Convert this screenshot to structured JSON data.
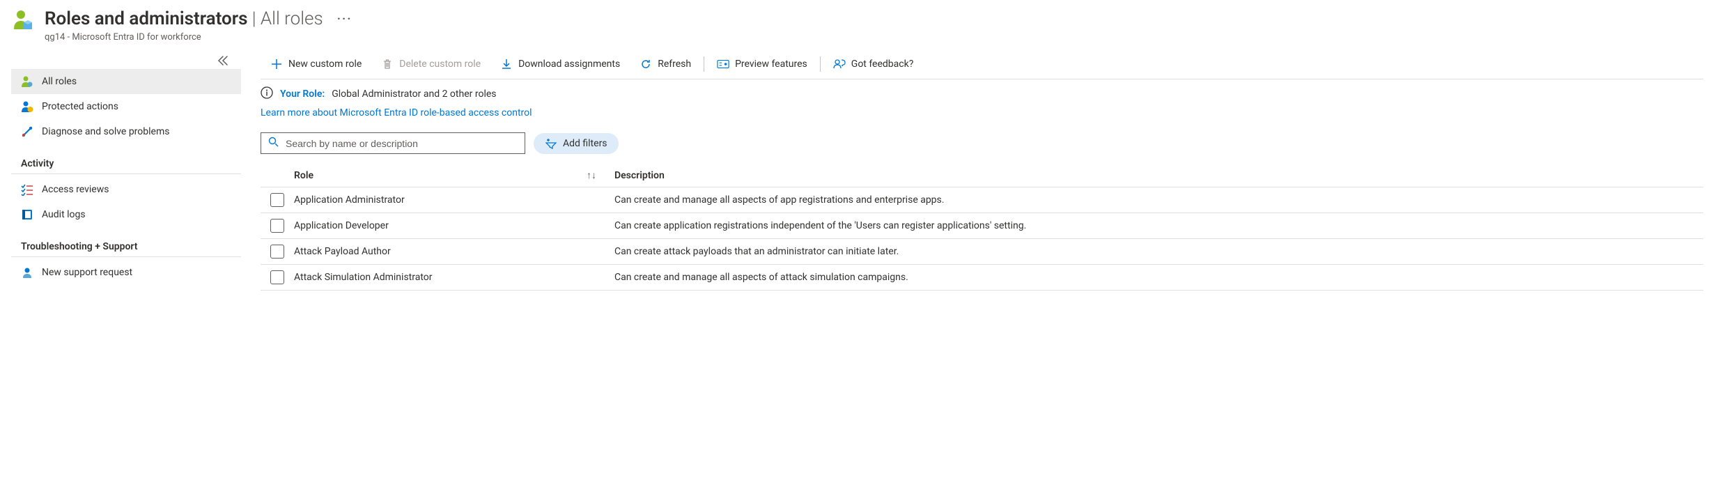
{
  "header": {
    "title_main": "Roles and administrators",
    "title_sep": " | ",
    "title_sub": "All roles",
    "subtitle": "qg14 - Microsoft Entra ID for workforce"
  },
  "sidebar": {
    "items": [
      {
        "label": "All roles",
        "icon": "person-roles-icon",
        "selected": true
      },
      {
        "label": "Protected actions",
        "icon": "person-shield-icon",
        "selected": false
      },
      {
        "label": "Diagnose and solve problems",
        "icon": "wrench-icon",
        "selected": false
      }
    ],
    "section_activity": "Activity",
    "activity_items": [
      {
        "label": "Access reviews",
        "icon": "checklist-icon"
      },
      {
        "label": "Audit logs",
        "icon": "book-icon"
      }
    ],
    "section_trouble": "Troubleshooting + Support",
    "trouble_items": [
      {
        "label": "New support request",
        "icon": "person-support-icon"
      }
    ]
  },
  "toolbar": {
    "new_custom_role": "New custom role",
    "delete_custom_role": "Delete custom role",
    "download_assignments": "Download assignments",
    "refresh": "Refresh",
    "preview_features": "Preview features",
    "got_feedback": "Got feedback?"
  },
  "info": {
    "your_role_label": "Your Role:",
    "your_role_value": "Global Administrator and 2 other roles",
    "learn_more": "Learn more about Microsoft Entra ID role-based access control"
  },
  "search": {
    "placeholder": "Search by name or description"
  },
  "filters": {
    "add_filters": "Add filters"
  },
  "table": {
    "col_role": "Role",
    "col_description": "Description",
    "rows": [
      {
        "role": "Application Administrator",
        "desc": "Can create and manage all aspects of app registrations and enterprise apps."
      },
      {
        "role": "Application Developer",
        "desc": "Can create application registrations independent of the 'Users can register applications' setting."
      },
      {
        "role": "Attack Payload Author",
        "desc": "Can create attack payloads that an administrator can initiate later."
      },
      {
        "role": "Attack Simulation Administrator",
        "desc": "Can create and manage all aspects of attack simulation campaigns."
      }
    ]
  }
}
